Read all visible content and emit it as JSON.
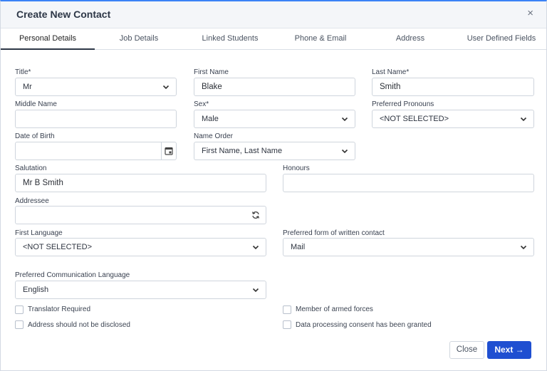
{
  "header": {
    "title": "Create New Contact",
    "close_glyph": "×"
  },
  "tabs": [
    {
      "label": "Personal Details",
      "active": true
    },
    {
      "label": "Job Details"
    },
    {
      "label": "Linked Students"
    },
    {
      "label": "Phone & Email"
    },
    {
      "label": "Address"
    },
    {
      "label": "User Defined Fields"
    }
  ],
  "form": {
    "title": {
      "label": "Title*",
      "value": "Mr"
    },
    "first_name": {
      "label": "First Name",
      "value": "Blake"
    },
    "last_name": {
      "label": "Last Name*",
      "value": "Smith"
    },
    "middle_name": {
      "label": "Middle Name",
      "value": ""
    },
    "sex": {
      "label": "Sex*",
      "value": "Male"
    },
    "pronouns": {
      "label": "Preferred Pronouns",
      "value": "<NOT SELECTED>"
    },
    "dob": {
      "label": "Date of Birth",
      "value": ""
    },
    "name_order": {
      "label": "Name Order",
      "value": "First Name, Last Name"
    },
    "salutation": {
      "label": "Salutation",
      "value": "Mr B Smith"
    },
    "honours": {
      "label": "Honours",
      "value": ""
    },
    "addressee": {
      "label": "Addressee",
      "value": ""
    },
    "first_language": {
      "label": "First Language",
      "value": "<NOT SELECTED>"
    },
    "written_contact": {
      "label": "Preferred form of written contact",
      "value": "Mail"
    },
    "comm_language": {
      "label": "Preferred Communication Language",
      "value": "English"
    }
  },
  "checkboxes": {
    "translator": {
      "label": "Translator Required",
      "checked": false
    },
    "armed_forces": {
      "label": "Member of armed forces",
      "checked": false
    },
    "not_disclosed": {
      "label": "Address should not be disclosed",
      "checked": false
    },
    "consent": {
      "label": "Data processing consent has been granted",
      "checked": false
    }
  },
  "footer": {
    "close_label": "Close",
    "next_label": "Next →"
  },
  "icons": {
    "select": "chevron-down-icon",
    "date": "calendar-icon",
    "addressee": "refresh-icon",
    "close": "close-icon"
  },
  "colors": {
    "accent": "#1f4fd1",
    "header_bg": "#f4f6f9",
    "top_border": "#3b82f6"
  }
}
